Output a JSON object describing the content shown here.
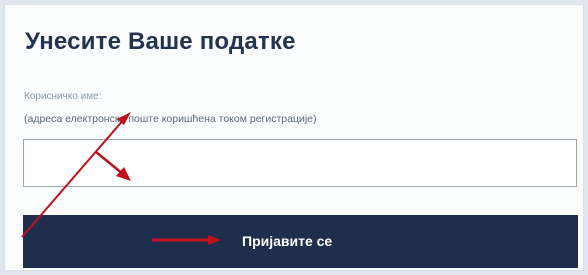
{
  "form": {
    "title": "Унесите Ваше податке",
    "username_label": "Корисничко име:",
    "username_hint": "(адреса електронске поште коришћена током регистрације)",
    "username_value": "",
    "submit_label": "Пријавите се"
  },
  "annotation": {
    "color": "#c0101a"
  },
  "colors": {
    "primary": "#1f2e4d",
    "title": "#23344f",
    "page_background": "#dfe6ee"
  }
}
